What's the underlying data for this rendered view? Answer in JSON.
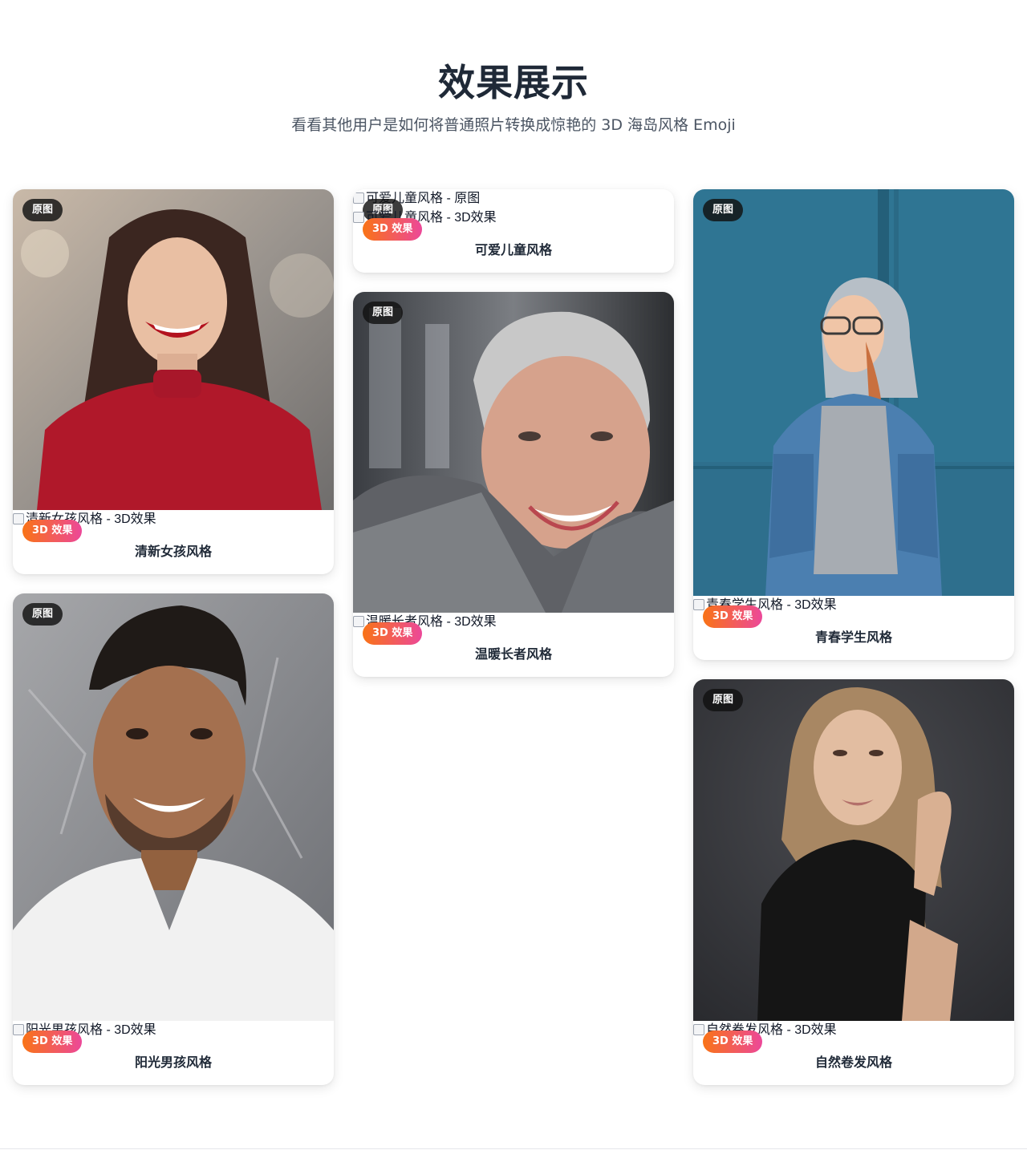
{
  "header": {
    "title": "效果展示",
    "subtitle": "看看其他用户是如何将普通照片转换成惊艳的 3D 海岛风格 Emoji"
  },
  "badges": {
    "original": "原图",
    "effect": "3D 效果"
  },
  "cards": [
    {
      "caption": "清新女孩风格",
      "alt_3d": "清新女孩风格 - 3D效果"
    },
    {
      "caption": "阳光男孩风格",
      "alt_3d": "阳光男孩风格 - 3D效果"
    },
    {
      "caption": "可爱儿童风格",
      "alt_original": "可爱儿童风格 - 原图",
      "alt_3d": "可爱儿童风格 - 3D效果"
    },
    {
      "caption": "温暖长者风格",
      "alt_3d": "温暖长者风格 - 3D效果"
    },
    {
      "caption": "青春学生风格",
      "alt_3d": "青春学生风格 - 3D效果"
    },
    {
      "caption": "自然卷发风格",
      "alt_3d": "自然卷发风格 - 3D效果"
    }
  ],
  "colors": {
    "badge_gradient_start": "#f97316",
    "badge_gradient_end": "#ec4899",
    "badge_original_bg": "#111111"
  }
}
